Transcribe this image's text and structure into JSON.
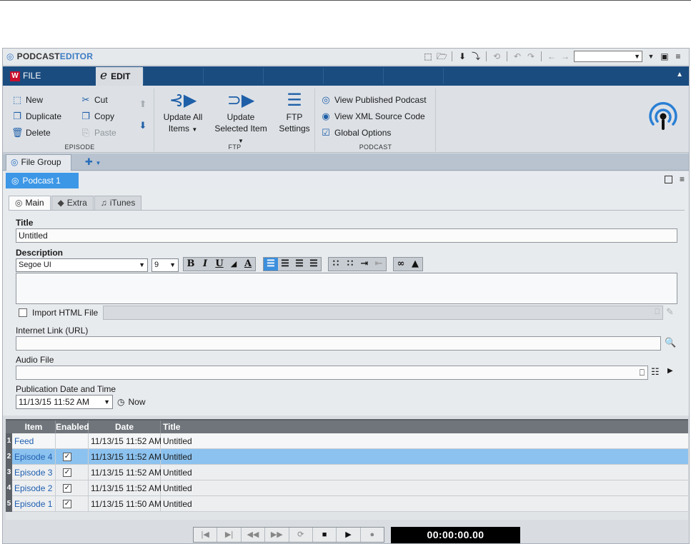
{
  "app": {
    "title_part1": "PODCAST",
    "title_part2": "EDITOR"
  },
  "ribbon_tabs": {
    "file": "FILE",
    "edit": "EDIT"
  },
  "ribbon": {
    "episode": {
      "label": "EPISODE",
      "new": "New",
      "duplicate": "Duplicate",
      "delete": "Delete",
      "cut": "Cut",
      "copy": "Copy",
      "paste": "Paste"
    },
    "ftp": {
      "label": "FTP",
      "update_all_1": "Update All",
      "update_all_2": "Items",
      "update_sel_1": "Update",
      "update_sel_2": "Selected Item",
      "settings_1": "FTP",
      "settings_2": "Settings"
    },
    "podcast": {
      "label": "PODCAST",
      "view_published": "View Published Podcast",
      "view_xml": "View XML Source Code",
      "global_options": "Global Options"
    }
  },
  "file_group": {
    "tab": "File Group"
  },
  "podcast_tab": "Podcast 1",
  "subtabs": {
    "main": "Main",
    "extra": "Extra",
    "itunes": "iTunes"
  },
  "form": {
    "title_label": "Title",
    "title_value": "Untitled",
    "description_label": "Description",
    "font_name": "Segoe UI",
    "font_size": "9",
    "import_html_label": "Import HTML File",
    "internet_link_label": "Internet Link (URL)",
    "audio_file_label": "Audio File",
    "pub_date_label": "Publication Date and Time",
    "pub_date_value": "11/13/15 11:52 AM",
    "now_label": "Now"
  },
  "table": {
    "headers": {
      "item": "Item",
      "enabled": "Enabled",
      "date": "Date",
      "title": "Title"
    },
    "rows": [
      {
        "num": "1",
        "item": "Feed",
        "enabled": false,
        "date": "11/13/15 11:52 AM",
        "title": "Untitled"
      },
      {
        "num": "2",
        "item": "Episode 4",
        "enabled": true,
        "date": "11/13/15 11:52 AM",
        "title": "Untitled"
      },
      {
        "num": "3",
        "item": "Episode 3",
        "enabled": true,
        "date": "11/13/15 11:52 AM",
        "title": "Untitled"
      },
      {
        "num": "4",
        "item": "Episode 2",
        "enabled": true,
        "date": "11/13/15 11:52 AM",
        "title": "Untitled"
      },
      {
        "num": "5",
        "item": "Episode 1",
        "enabled": true,
        "date": "11/13/15 11:50 AM",
        "title": "Untitled"
      }
    ]
  },
  "transport": {
    "time": "00:00:00.00"
  },
  "colors": {
    "ribbon_tab_bar": "#1b4c7f",
    "accent": "#3c97e6",
    "selection": "#8cc2ef",
    "link": "#1f5fb0",
    "wavelab_red": "#c8102e"
  }
}
